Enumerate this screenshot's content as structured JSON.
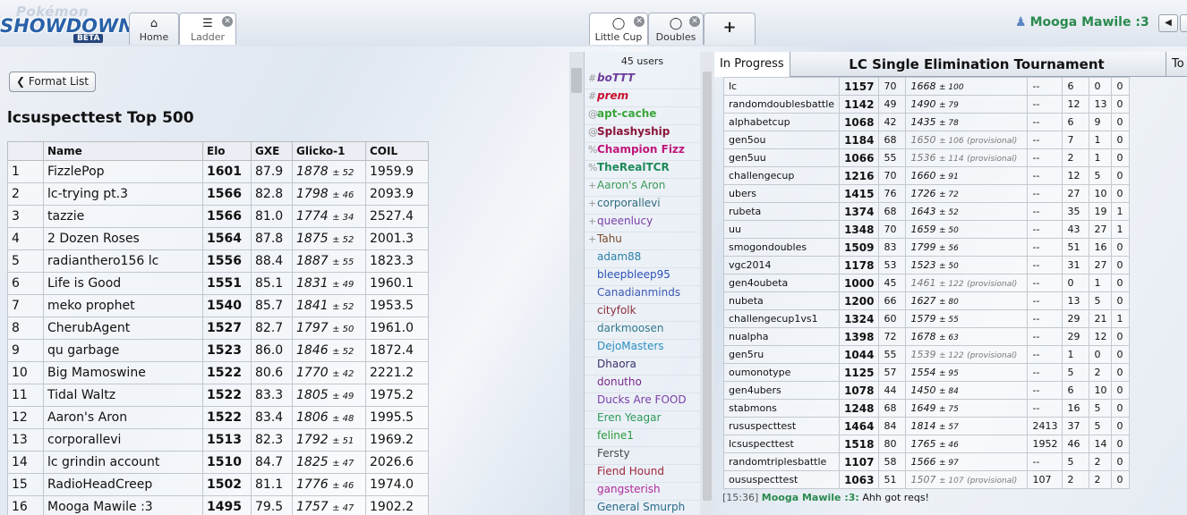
{
  "logo": {
    "top": "Pokémon",
    "main": "SHOWDOWN!",
    "badge": "BETA"
  },
  "tabs": {
    "home": {
      "label": "Home",
      "icon": "home-icon"
    },
    "ladder": {
      "label": "Ladder",
      "icon": "list-icon"
    },
    "little_cup": {
      "label": "Little Cup",
      "icon": "speech-bubble-icon"
    },
    "doubles": {
      "label": "Doubles",
      "icon": "speech-bubble-icon"
    },
    "add": {
      "label": "+"
    }
  },
  "user": {
    "name": "Mooga Mawile :3",
    "icon": "user-icon"
  },
  "ladder": {
    "format_button": "Format List",
    "title": "lcsuspecttest Top 500",
    "headers": [
      "",
      "Name",
      "Elo",
      "GXE",
      "Glicko-1",
      "COIL"
    ],
    "rows": [
      {
        "rank": "1",
        "name": "FizzlePop",
        "elo": "1601",
        "gxe": "87.9",
        "glicko": "1878",
        "dev": "± 52",
        "coil": "1959.9"
      },
      {
        "rank": "2",
        "name": "lc-trying pt.3",
        "elo": "1566",
        "gxe": "82.8",
        "glicko": "1798",
        "dev": "± 46",
        "coil": "2093.9"
      },
      {
        "rank": "3",
        "name": "tazzie",
        "elo": "1566",
        "gxe": "81.0",
        "glicko": "1774",
        "dev": "± 34",
        "coil": "2527.4"
      },
      {
        "rank": "4",
        "name": "2 Dozen Roses",
        "elo": "1564",
        "gxe": "87.8",
        "glicko": "1875",
        "dev": "± 52",
        "coil": "2001.3"
      },
      {
        "rank": "5",
        "name": "radianthero156 lc",
        "elo": "1556",
        "gxe": "88.4",
        "glicko": "1887",
        "dev": "± 55",
        "coil": "1823.3"
      },
      {
        "rank": "6",
        "name": "Life is Good",
        "elo": "1551",
        "gxe": "85.1",
        "glicko": "1831",
        "dev": "± 49",
        "coil": "1960.1"
      },
      {
        "rank": "7",
        "name": "meko prophet",
        "elo": "1540",
        "gxe": "85.7",
        "glicko": "1841",
        "dev": "± 52",
        "coil": "1953.5"
      },
      {
        "rank": "8",
        "name": "CherubAgent",
        "elo": "1527",
        "gxe": "82.7",
        "glicko": "1797",
        "dev": "± 50",
        "coil": "1961.0"
      },
      {
        "rank": "9",
        "name": "qu garbage",
        "elo": "1523",
        "gxe": "86.0",
        "glicko": "1846",
        "dev": "± 52",
        "coil": "1872.4"
      },
      {
        "rank": "10",
        "name": "Big Mamoswine",
        "elo": "1522",
        "gxe": "80.6",
        "glicko": "1770",
        "dev": "± 42",
        "coil": "2221.2"
      },
      {
        "rank": "11",
        "name": "Tidal Waltz",
        "elo": "1522",
        "gxe": "83.3",
        "glicko": "1805",
        "dev": "± 49",
        "coil": "1975.2"
      },
      {
        "rank": "12",
        "name": "Aaron's Aron",
        "elo": "1522",
        "gxe": "83.4",
        "glicko": "1806",
        "dev": "± 48",
        "coil": "1995.5"
      },
      {
        "rank": "13",
        "name": "corporallevi",
        "elo": "1513",
        "gxe": "82.3",
        "glicko": "1792",
        "dev": "± 51",
        "coil": "1969.2"
      },
      {
        "rank": "14",
        "name": "lc grindin account",
        "elo": "1510",
        "gxe": "84.7",
        "glicko": "1825",
        "dev": "± 47",
        "coil": "2026.6"
      },
      {
        "rank": "15",
        "name": "RadioHeadCreep",
        "elo": "1502",
        "gxe": "81.1",
        "glicko": "1776",
        "dev": "± 46",
        "coil": "1974.0"
      },
      {
        "rank": "16",
        "name": "Mooga Mawile :3",
        "elo": "1495",
        "gxe": "79.5",
        "glicko": "1757",
        "dev": "± 47",
        "coil": "1902.2"
      }
    ]
  },
  "userlist": {
    "count": "45 users",
    "users": [
      {
        "group": "#",
        "name": "boTTT",
        "color": "#6a3d9a",
        "style": "bi"
      },
      {
        "group": "#",
        "name": "prem",
        "color": "#c8102e",
        "style": "bi"
      },
      {
        "group": "@",
        "name": "apt-cache",
        "color": "#3aa63a",
        "style": "b"
      },
      {
        "group": "@",
        "name": "Splashyship",
        "color": "#8a1538",
        "style": "b"
      },
      {
        "group": "%",
        "name": "Champion Fizz",
        "color": "#c0167a",
        "style": "b"
      },
      {
        "group": "%",
        "name": "TheRealTCR",
        "color": "#1f8a5a",
        "style": "b"
      },
      {
        "group": "+",
        "name": "Aaron's Aron",
        "color": "#3c9a54",
        "style": ""
      },
      {
        "group": "+",
        "name": "corporallevi",
        "color": "#2f6b7c",
        "style": ""
      },
      {
        "group": "+",
        "name": "queenlucy",
        "color": "#7a3fa6",
        "style": ""
      },
      {
        "group": "+",
        "name": "Tahu",
        "color": "#7b4a2c",
        "style": ""
      },
      {
        "group": "",
        "name": "adam88",
        "color": "#2a7fa8",
        "style": ""
      },
      {
        "group": "",
        "name": "bleepbleep95",
        "color": "#2b52b8",
        "style": ""
      },
      {
        "group": "",
        "name": "Canadianminds",
        "color": "#3a58b0",
        "style": ""
      },
      {
        "group": "",
        "name": "cityfolk",
        "color": "#8a2f3a",
        "style": ""
      },
      {
        "group": "",
        "name": "darkmoosen",
        "color": "#2f7a8a",
        "style": ""
      },
      {
        "group": "",
        "name": "DejoMasters",
        "color": "#2a8fc0",
        "style": ""
      },
      {
        "group": "",
        "name": "Dhaora",
        "color": "#3a2f6a",
        "style": ""
      },
      {
        "group": "",
        "name": "donutho",
        "color": "#7a2a8a",
        "style": ""
      },
      {
        "group": "",
        "name": "Ducks Are FOOD",
        "color": "#7a3fa6",
        "style": ""
      },
      {
        "group": "",
        "name": "Eren Yeagar",
        "color": "#2f9a5a",
        "style": ""
      },
      {
        "group": "",
        "name": "feline1",
        "color": "#2a9a3a",
        "style": ""
      },
      {
        "group": "",
        "name": "Fersty",
        "color": "#4a4a4a",
        "style": ""
      },
      {
        "group": "",
        "name": "Fiend Hound",
        "color": "#a0283a",
        "style": ""
      },
      {
        "group": "",
        "name": "gangsterish",
        "color": "#b02a9a",
        "style": ""
      },
      {
        "group": "",
        "name": "General Smurph",
        "color": "#2a6a8a",
        "style": ""
      }
    ]
  },
  "tournament": {
    "status": "In Progress",
    "title": "LC Single Elimination Tournament",
    "extra": "To"
  },
  "rank_table": [
    {
      "format": "lc",
      "elo": "1157",
      "gxe": "70",
      "glicko": "1668",
      "dev": "± 100",
      "prov": "",
      "coil": "--",
      "w": "6",
      "l": "0",
      "t": "0"
    },
    {
      "format": "randomdoublesbattle",
      "elo": "1142",
      "gxe": "49",
      "glicko": "1490",
      "dev": "± 79",
      "prov": "",
      "coil": "--",
      "w": "12",
      "l": "13",
      "t": "0"
    },
    {
      "format": "alphabetcup",
      "elo": "1068",
      "gxe": "42",
      "glicko": "1435",
      "dev": "± 78",
      "prov": "",
      "coil": "--",
      "w": "6",
      "l": "9",
      "t": "0"
    },
    {
      "format": "gen5ou",
      "elo": "1184",
      "gxe": "68",
      "glicko": "1650",
      "dev": "± 106",
      "prov": "(provisional)",
      "coil": "--",
      "w": "7",
      "l": "1",
      "t": "0"
    },
    {
      "format": "gen5uu",
      "elo": "1066",
      "gxe": "55",
      "glicko": "1536",
      "dev": "± 114",
      "prov": "(provisional)",
      "coil": "--",
      "w": "2",
      "l": "1",
      "t": "0"
    },
    {
      "format": "challengecup",
      "elo": "1216",
      "gxe": "70",
      "glicko": "1660",
      "dev": "± 91",
      "prov": "",
      "coil": "--",
      "w": "12",
      "l": "5",
      "t": "0"
    },
    {
      "format": "ubers",
      "elo": "1415",
      "gxe": "76",
      "glicko": "1726",
      "dev": "± 72",
      "prov": "",
      "coil": "--",
      "w": "27",
      "l": "10",
      "t": "0"
    },
    {
      "format": "rubeta",
      "elo": "1374",
      "gxe": "68",
      "glicko": "1643",
      "dev": "± 52",
      "prov": "",
      "coil": "--",
      "w": "35",
      "l": "19",
      "t": "1"
    },
    {
      "format": "uu",
      "elo": "1348",
      "gxe": "70",
      "glicko": "1659",
      "dev": "± 50",
      "prov": "",
      "coil": "--",
      "w": "43",
      "l": "27",
      "t": "1"
    },
    {
      "format": "smogondoubles",
      "elo": "1509",
      "gxe": "83",
      "glicko": "1799",
      "dev": "± 56",
      "prov": "",
      "coil": "--",
      "w": "51",
      "l": "16",
      "t": "0"
    },
    {
      "format": "vgc2014",
      "elo": "1178",
      "gxe": "53",
      "glicko": "1523",
      "dev": "± 50",
      "prov": "",
      "coil": "--",
      "w": "31",
      "l": "27",
      "t": "0"
    },
    {
      "format": "gen4oubeta",
      "elo": "1000",
      "gxe": "45",
      "glicko": "1461",
      "dev": "± 122",
      "prov": "(provisional)",
      "coil": "--",
      "w": "0",
      "l": "1",
      "t": "0"
    },
    {
      "format": "nubeta",
      "elo": "1200",
      "gxe": "66",
      "glicko": "1627",
      "dev": "± 80",
      "prov": "",
      "coil": "--",
      "w": "13",
      "l": "5",
      "t": "0"
    },
    {
      "format": "challengecup1vs1",
      "elo": "1324",
      "gxe": "60",
      "glicko": "1579",
      "dev": "± 55",
      "prov": "",
      "coil": "--",
      "w": "29",
      "l": "21",
      "t": "1"
    },
    {
      "format": "nualpha",
      "elo": "1398",
      "gxe": "72",
      "glicko": "1678",
      "dev": "± 63",
      "prov": "",
      "coil": "--",
      "w": "29",
      "l": "12",
      "t": "0"
    },
    {
      "format": "gen5ru",
      "elo": "1044",
      "gxe": "55",
      "glicko": "1539",
      "dev": "± 122",
      "prov": "(provisional)",
      "coil": "--",
      "w": "1",
      "l": "0",
      "t": "0"
    },
    {
      "format": "oumonotype",
      "elo": "1125",
      "gxe": "57",
      "glicko": "1554",
      "dev": "± 95",
      "prov": "",
      "coil": "--",
      "w": "5",
      "l": "2",
      "t": "0"
    },
    {
      "format": "gen4ubers",
      "elo": "1078",
      "gxe": "44",
      "glicko": "1450",
      "dev": "± 84",
      "prov": "",
      "coil": "--",
      "w": "6",
      "l": "10",
      "t": "0"
    },
    {
      "format": "stabmons",
      "elo": "1248",
      "gxe": "68",
      "glicko": "1649",
      "dev": "± 75",
      "prov": "",
      "coil": "--",
      "w": "16",
      "l": "5",
      "t": "0"
    },
    {
      "format": "rususpecttest",
      "elo": "1464",
      "gxe": "84",
      "glicko": "1814",
      "dev": "± 57",
      "prov": "",
      "coil": "2413",
      "w": "37",
      "l": "5",
      "t": "0"
    },
    {
      "format": "lcsuspecttest",
      "elo": "1518",
      "gxe": "80",
      "glicko": "1765",
      "dev": "± 46",
      "prov": "",
      "coil": "1952",
      "w": "46",
      "l": "14",
      "t": "0"
    },
    {
      "format": "randomtriplesbattle",
      "elo": "1107",
      "gxe": "58",
      "glicko": "1566",
      "dev": "± 97",
      "prov": "",
      "coil": "--",
      "w": "5",
      "l": "2",
      "t": "0"
    },
    {
      "format": "oususpecttest",
      "elo": "1063",
      "gxe": "51",
      "glicko": "1507",
      "dev": "± 107",
      "prov": "(provisional)",
      "coil": "107",
      "w": "2",
      "l": "2",
      "t": "0"
    }
  ],
  "chat": {
    "timestamp": "[15:36]",
    "user": "Mooga Mawile :3:",
    "message": "Ahh got reqs!"
  }
}
